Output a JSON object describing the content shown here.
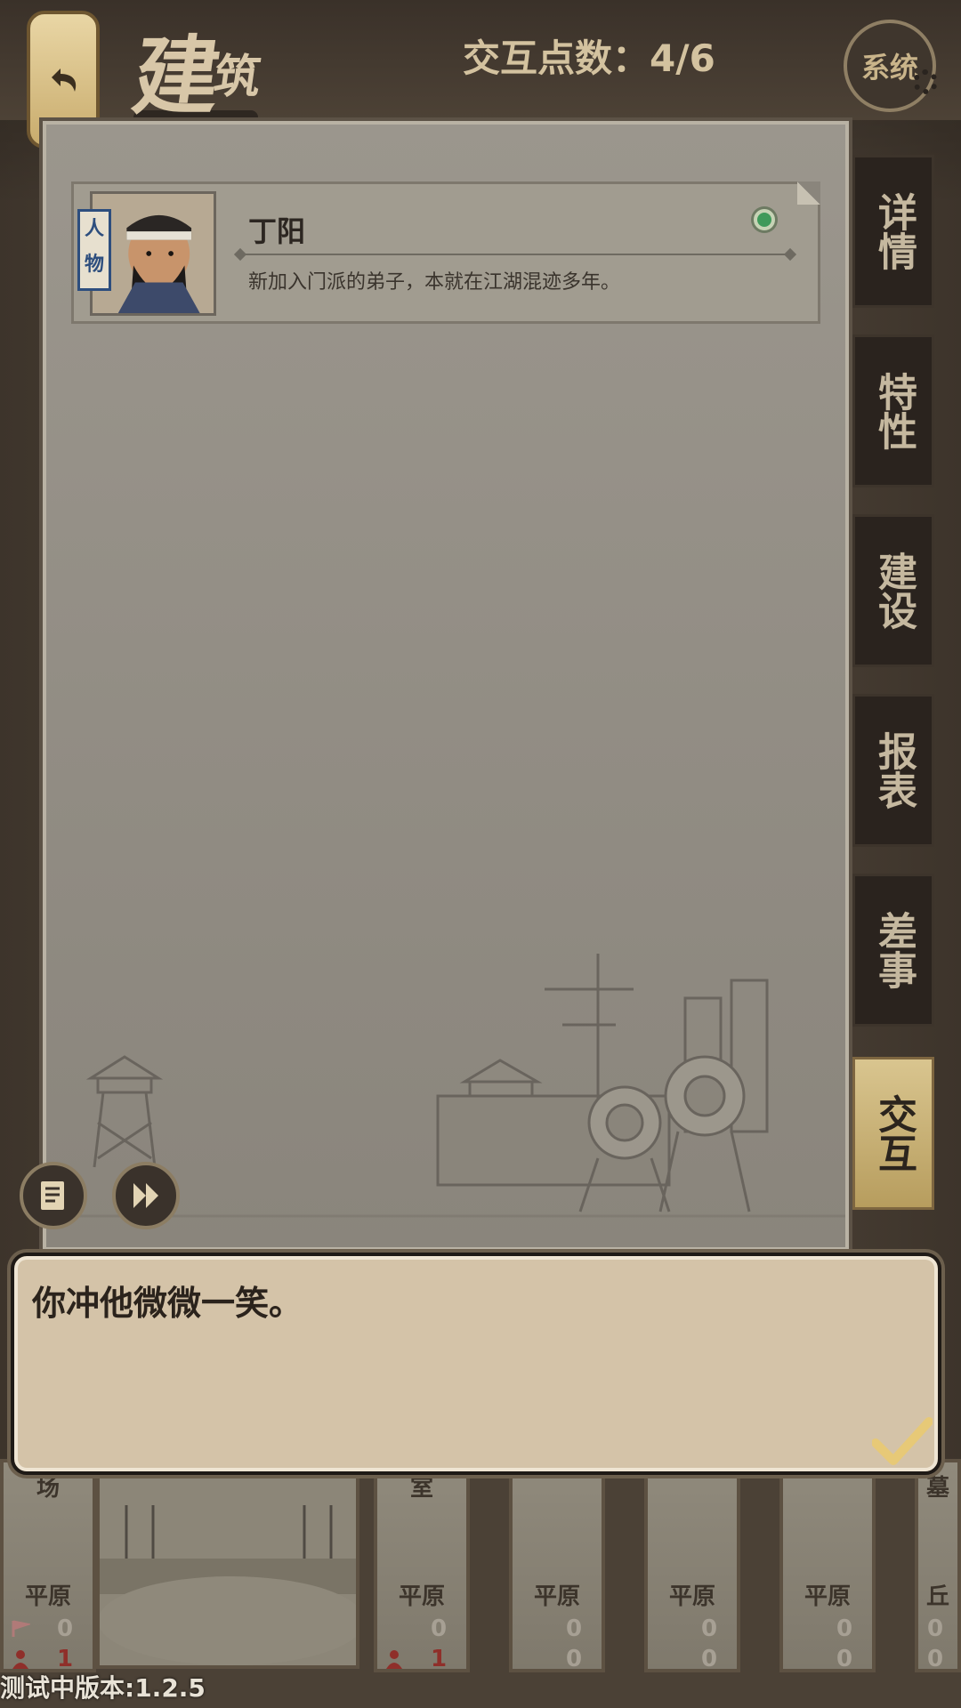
{
  "header": {
    "title": "建",
    "title_sub": "筑",
    "interaction_points": "交互点数：4/6",
    "system_label": "系统"
  },
  "character": {
    "tag": "人物",
    "name": "丁阳",
    "description": "新加入门派的弟子，本就在江湖混迹多年。"
  },
  "tabs": [
    {
      "label": "详情"
    },
    {
      "label": "特性"
    },
    {
      "label": "建设"
    },
    {
      "label": "报表"
    },
    {
      "label": "差事"
    },
    {
      "label": "交互",
      "active": true
    }
  ],
  "dialog": {
    "text": "你冲他微微一笑。"
  },
  "buildings": [
    {
      "name": "场",
      "terrain": "平原",
      "stat1": "0",
      "stat2": "1"
    },
    {
      "name": "室",
      "terrain": "平原",
      "stat1": "0",
      "stat2": "1"
    },
    {
      "name": "",
      "terrain": "平原",
      "stat1": "0",
      "stat2": "0"
    },
    {
      "name": "",
      "terrain": "平原",
      "stat1": "0",
      "stat2": "0"
    },
    {
      "name": "",
      "terrain": "平原",
      "stat1": "0",
      "stat2": "0"
    },
    {
      "name": "墓",
      "terrain": "丘",
      "stat1": "0",
      "stat2": "0"
    }
  ],
  "version": "测试中版本:1.2.5",
  "colors": {
    "accent": "#c9ac6d",
    "status_online": "#3f9a5a",
    "stat_red": "#8f2f2a"
  }
}
